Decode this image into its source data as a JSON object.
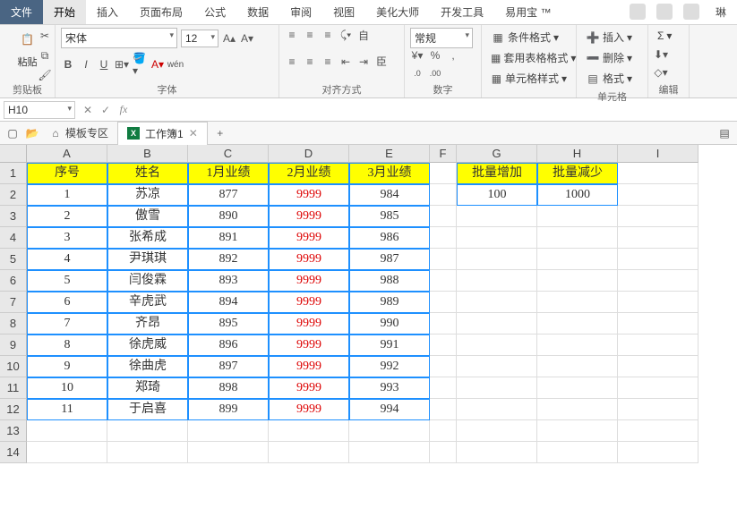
{
  "menubar": {
    "file": "文件",
    "tabs": [
      "开始",
      "插入",
      "页面布局",
      "公式",
      "数据",
      "审阅",
      "视图",
      "美化大师",
      "开发工具",
      "易用宝 ™"
    ],
    "active": 0,
    "tail": "琳"
  },
  "ribbon": {
    "clipboard": {
      "label": "剪贴板",
      "paste": "粘贴"
    },
    "font": {
      "label": "字体",
      "name": "宋体",
      "size": "12",
      "bold": "B",
      "italic": "I",
      "underline": "U",
      "wen": "wén"
    },
    "align": {
      "label": "对齐方式",
      "wrap": "自",
      "merge": "臣"
    },
    "number": {
      "label": "数字",
      "fmt": "常规",
      "pct": "%",
      "comma": ","
    },
    "styles": {
      "cond": "条件格式",
      "tbl": "套用表格格式",
      "cell": "单元格样式"
    },
    "cells": {
      "label": "单元格",
      "ins": "插入",
      "del": "删除",
      "fmt": "格式"
    },
    "edit": {
      "label": "编辑",
      "sigma": "Σ"
    }
  },
  "namebox": {
    "ref": "H10"
  },
  "tabbar": {
    "tpl": "模板专区",
    "book": "工作簿1"
  },
  "columns": [
    "A",
    "B",
    "C",
    "D",
    "E",
    "F",
    "G",
    "H",
    "I"
  ],
  "rowcount": 14,
  "headers": {
    "A": "序号",
    "B": "姓名",
    "C": "1月业绩",
    "D": "2月业绩",
    "E": "3月业绩",
    "G": "批量增加",
    "H": "批量减少"
  },
  "side": {
    "G": "100",
    "H": "1000"
  },
  "data": [
    {
      "n": "1",
      "name": "苏凉",
      "c": "877",
      "d": "9999",
      "e": "984"
    },
    {
      "n": "2",
      "name": "傲雪",
      "c": "890",
      "d": "9999",
      "e": "985"
    },
    {
      "n": "3",
      "name": "张希成",
      "c": "891",
      "d": "9999",
      "e": "986"
    },
    {
      "n": "4",
      "name": "尹琪琪",
      "c": "892",
      "d": "9999",
      "e": "987"
    },
    {
      "n": "5",
      "name": "闫俊霖",
      "c": "893",
      "d": "9999",
      "e": "988"
    },
    {
      "n": "6",
      "name": "辛虎武",
      "c": "894",
      "d": "9999",
      "e": "989"
    },
    {
      "n": "7",
      "name": "齐昂",
      "c": "895",
      "d": "9999",
      "e": "990"
    },
    {
      "n": "8",
      "name": "徐虎威",
      "c": "896",
      "d": "9999",
      "e": "991"
    },
    {
      "n": "9",
      "name": "徐曲虎",
      "c": "897",
      "d": "9999",
      "e": "992"
    },
    {
      "n": "10",
      "name": "郑琦",
      "c": "898",
      "d": "9999",
      "e": "993"
    },
    {
      "n": "11",
      "name": "于启喜",
      "c": "899",
      "d": "9999",
      "e": "994"
    }
  ]
}
